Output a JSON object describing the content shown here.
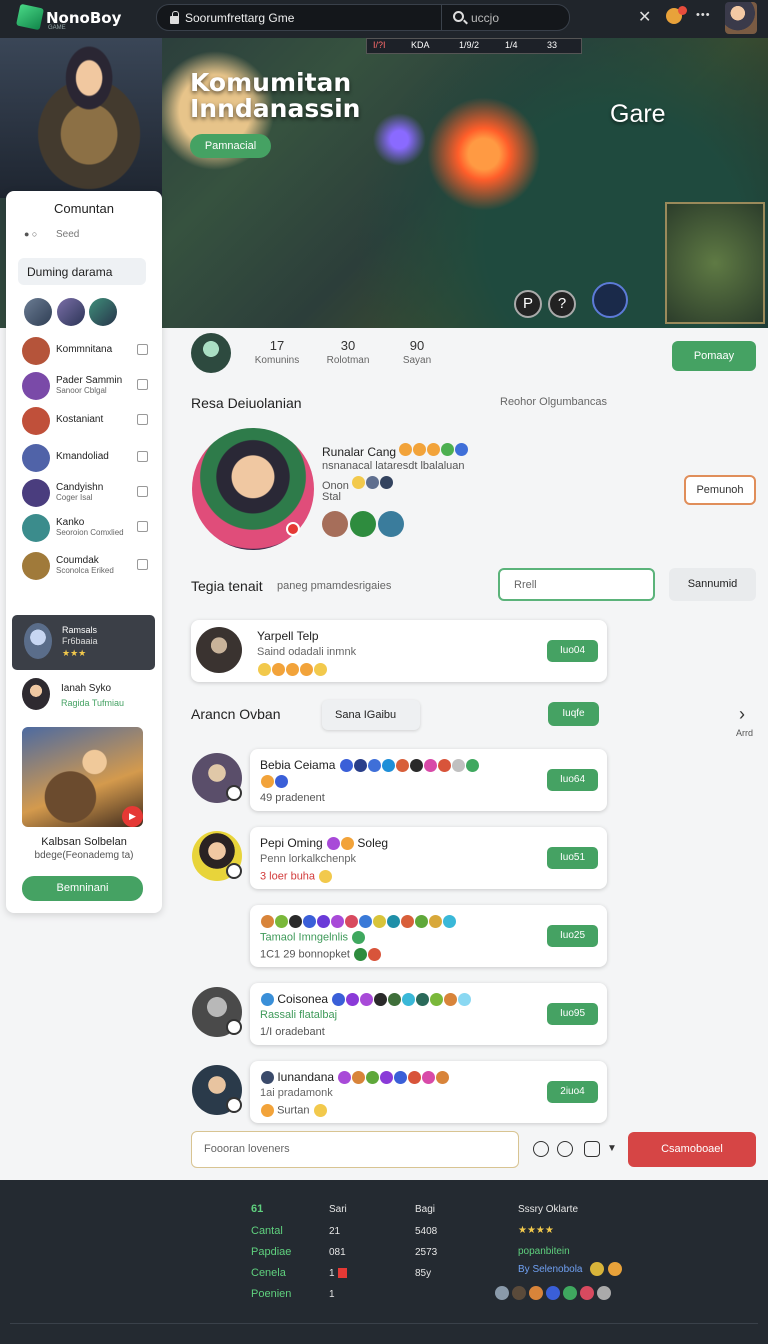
{
  "topbar": {
    "brand": "NonoBoy",
    "brand_sub": "GAME",
    "search_text": "Soorumfrettarg Gme",
    "search_right": "uccjo",
    "close": "✕",
    "more": "•••"
  },
  "hero": {
    "title_line1": "Komumitan",
    "title_line2": "Inndanassin",
    "button": "Pamnacial",
    "label": "Gare",
    "hud": [
      "I/?I",
      "KDA",
      "1/9/2",
      "1/4",
      "33"
    ],
    "skills": [
      "P",
      "?"
    ]
  },
  "sidebar": {
    "title": "Comuntan",
    "seed": "Seed",
    "pill": "Duming darama",
    "items": [
      {
        "name": "Kommnitana",
        "sub": "",
        "color": "#b5543a"
      },
      {
        "name": "Pader Sammin",
        "sub": "Sanoor Cblgal",
        "color": "#7a4aa8"
      },
      {
        "name": "Kostaniant",
        "sub": "",
        "color": "#c0503a"
      },
      {
        "name": "Kmandoliad",
        "sub": "",
        "color": "#5063a8"
      },
      {
        "name": "Candyishn",
        "sub": "Coger Isal",
        "color": "#4a3d7e"
      },
      {
        "name": "Kanko",
        "sub": "Seoroion Comxlied",
        "color": "#3b8c8c"
      },
      {
        "name": "Coumdak",
        "sub": "Sconolca Eriked",
        "color": "#a07a3a"
      }
    ],
    "dark_card": {
      "line1": "Ramsals",
      "line2": "Fr6baaia",
      "line3": "★★★"
    },
    "user": {
      "name": "Ianah Syko",
      "sub": "Ragida Tufmiau"
    },
    "featured_title": "Kalbsan Solbelan",
    "featured_sub": "bdege(Feonademg ta)",
    "button": "Bemninani"
  },
  "stats": [
    {
      "value": "17",
      "label": "Komunins"
    },
    {
      "value": "30",
      "label": "Rolotman"
    },
    {
      "value": "90",
      "label": "Sayan"
    }
  ],
  "primary_button": "Pomaay",
  "section1": {
    "title": "Resa Deiuolanian",
    "right": "Reohor Olgumbancas"
  },
  "profile": {
    "name": "Runalar Cang",
    "line1": "nsnanacal lataresdt lbalaluan",
    "line2": "Onon",
    "line3": "Stal",
    "action": "Pemunoh"
  },
  "filter": {
    "title": "Tegia tenait",
    "hint": "paneg pmamdesrigaies",
    "input_value": "Rrell",
    "button": "Sannumid"
  },
  "first_card": {
    "title": "Yarpell Telp",
    "sub": "Saind odadali inmnk",
    "button": "Iuo04"
  },
  "section2": {
    "title": "Arancn Ovban",
    "chip": "Sana IGaibu",
    "button": "Iuqfe",
    "next_label": "Arrd"
  },
  "cards": [
    {
      "title": "Bebia Ceiama",
      "sub": "",
      "meta": "49 pradenent",
      "button": "Iuo64",
      "meta_color": "#555"
    },
    {
      "title": "Pepi Oming",
      "title_suffix": "Soleg",
      "sub": "Penn lorkalkchenpk",
      "meta": "3 loer buha",
      "button": "Iuo51",
      "meta_color": "#d23b3b"
    },
    {
      "title": "",
      "sub": "Tamaol Imngelnlis",
      "meta": "1C1 29 bonnopket",
      "button": "Iuo25",
      "meta_color": "#555"
    },
    {
      "title": "Coisonea",
      "sub": "Rassali flatalbaj",
      "meta": "1/I oradebant",
      "button": "Iuo95",
      "meta_color": "#555"
    },
    {
      "title": "Iunandana",
      "sub": "1ai pradamonk",
      "meta": "Surtan",
      "button": "2iuo4",
      "meta_color": "#555"
    }
  ],
  "comment": {
    "placeholder": "Foooran loveners",
    "button": "Csamoboael"
  },
  "footer": {
    "col1": [
      "61",
      "Cantal",
      "Papdiae",
      "Cenela",
      "Poenien"
    ],
    "col2": [
      "Sari",
      "21",
      "081",
      "1",
      "1"
    ],
    "col3": [
      "Bagi",
      "5408",
      "2573",
      "85y",
      ""
    ],
    "col4_title": "Sssry Oklarte",
    "col4_stars": "★★★★",
    "col4_line1": "popanbitein",
    "col4_line2": "By Selenobola"
  },
  "colors": {
    "accent": "#45a263",
    "danger": "#d64545",
    "dark": "#20252b"
  }
}
